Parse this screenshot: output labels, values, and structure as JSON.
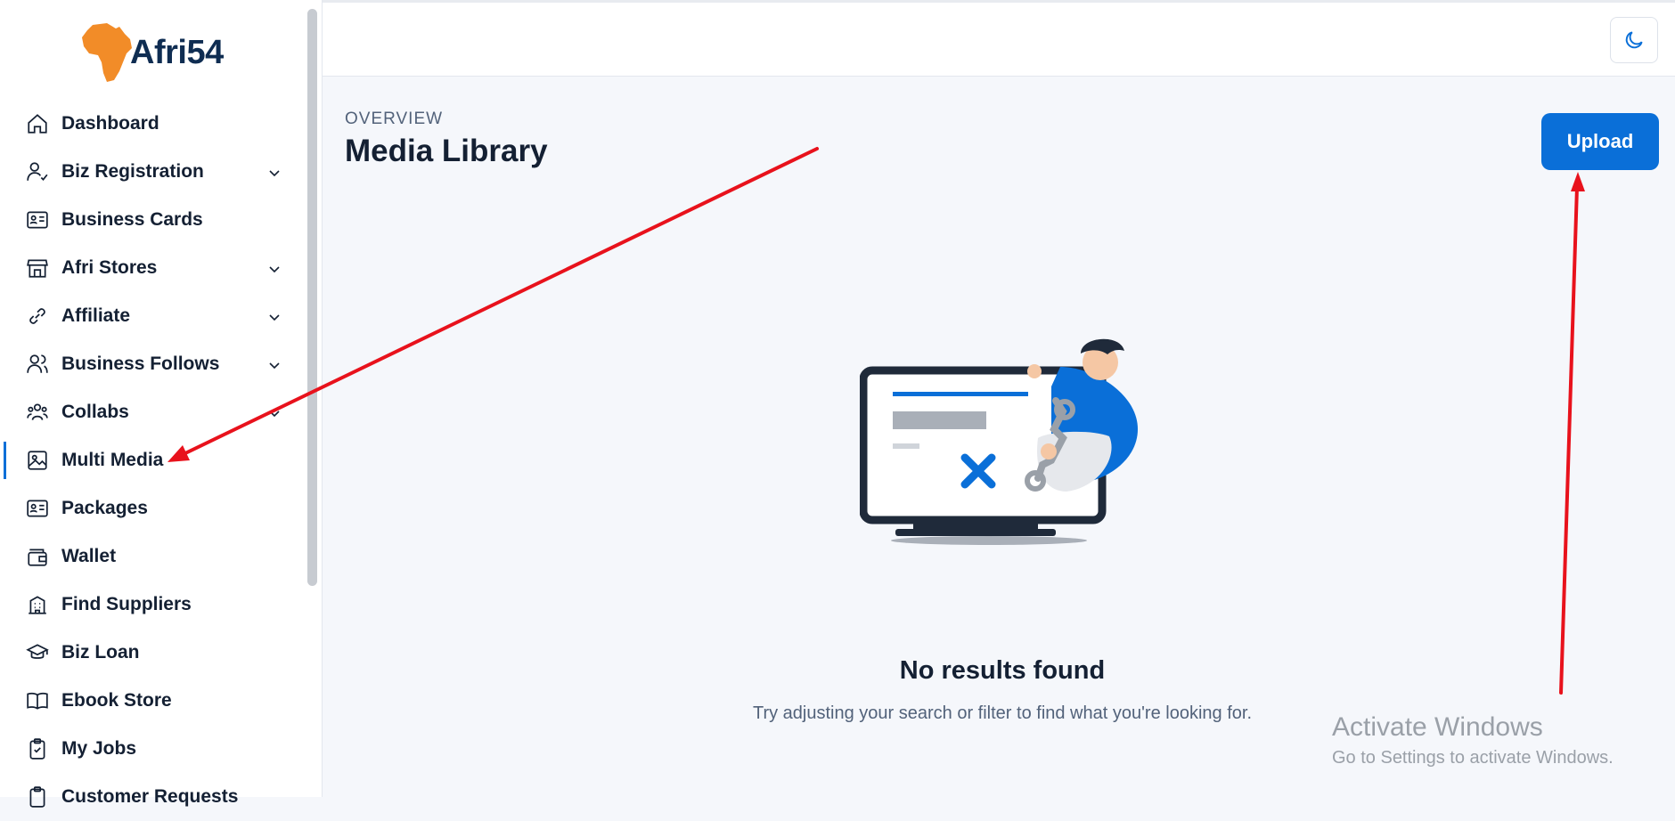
{
  "brand": {
    "name": "Afri54",
    "logo_color": "#f28c28"
  },
  "sidebar": {
    "items": [
      {
        "label": "Dashboard",
        "icon": "home-icon",
        "chevron": false
      },
      {
        "label": "Biz Registration",
        "icon": "user-check-icon",
        "chevron": true
      },
      {
        "label": "Business Cards",
        "icon": "id-card-icon",
        "chevron": false
      },
      {
        "label": "Afri Stores",
        "icon": "store-icon",
        "chevron": true
      },
      {
        "label": "Affiliate",
        "icon": "link-icon",
        "chevron": true
      },
      {
        "label": "Business Follows",
        "icon": "users-icon",
        "chevron": true
      },
      {
        "label": "Collabs",
        "icon": "group-icon",
        "chevron": true
      },
      {
        "label": "Multi Media",
        "icon": "image-icon",
        "chevron": false,
        "active": true
      },
      {
        "label": "Packages",
        "icon": "id-card-icon",
        "chevron": false
      },
      {
        "label": "Wallet",
        "icon": "wallet-icon",
        "chevron": false
      },
      {
        "label": "Find Suppliers",
        "icon": "building-icon",
        "chevron": false
      },
      {
        "label": "Biz Loan",
        "icon": "graduation-cap-icon",
        "chevron": false
      },
      {
        "label": "Ebook Store",
        "icon": "book-icon",
        "chevron": false
      },
      {
        "label": "My Jobs",
        "icon": "clipboard-check-icon",
        "chevron": false
      },
      {
        "label": "Customer Requests",
        "icon": "clipboard-icon",
        "chevron": false
      }
    ]
  },
  "header": {
    "theme_toggle_icon": "moon-icon"
  },
  "main": {
    "eyebrow": "OVERVIEW",
    "title": "Media Library",
    "upload_label": "Upload",
    "empty_title": "No results found",
    "empty_subtitle": "Try adjusting your search or filter to find what you're looking for."
  },
  "watermark": {
    "title": "Activate Windows",
    "subtitle": "Go to Settings to activate Windows."
  },
  "colors": {
    "accent": "#0a6fd8",
    "text": "#142033",
    "annotation": "#e8121c"
  }
}
